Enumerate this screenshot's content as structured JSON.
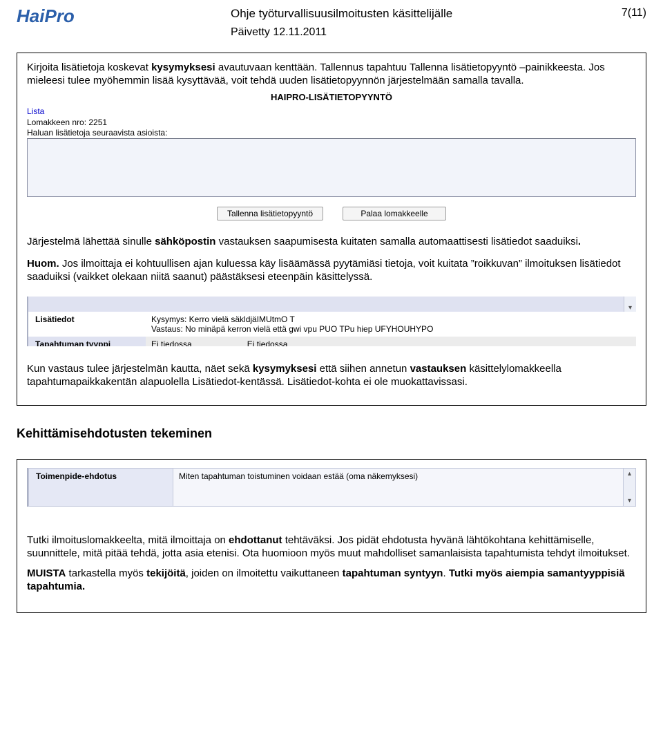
{
  "header": {
    "logo": "HaiPro",
    "title": "Ohje työturvallisuusilmoitusten käsittelijälle",
    "updated": "Päivetty 12.11.2011",
    "pagenum": "7(11)"
  },
  "box1": {
    "p1a": "Kirjoita lisätietoja koskevat ",
    "p1b": "kysymyksesi",
    "p1c": " avautuvaan kenttään. Tallennus tapahtuu Tallenna lisätietopyyntö –painikkeesta. ",
    "p2a": "J",
    "p2b": "os mieleesi tulee myöhemmin lisää kysyttävää, voit tehdä uuden lisätietopyynnön järjestelmään samalla tavalla.",
    "shot1": {
      "title": "HAIPRO-LISÄTIETOPYYNTÖ",
      "link": "Lista",
      "line1": "Lomakkeen nro: 2251",
      "line2": "Haluan lisätietoja seuraavista asioista:",
      "btn1": "Tallenna lisätietopyyntö",
      "btn2": "Palaa lomakkeelle"
    },
    "p3a": "Järjestelmä lähettää sinulle ",
    "p3b": "sähköpostin",
    "p3c": " vastauksen saapumisesta kuitaten samalla automaattisesti lisätiedot saaduiksi",
    "p3d": ".",
    "p4a": "Huom.",
    "p4b": " Jos ilmoittaja ei kohtuullisen ajan kuluessa käy lisäämässä pyytämiäsi tietoja, voit kuitata ”roikkuvan” ilmoituksen lisätiedot saaduiksi (vaikket olekaan niitä saanut) päästäksesi eteenpäin käsittelyssä.",
    "shot2": {
      "labelA": "Lisätiedot",
      "q_label": "Kysymys: ",
      "q_text": "Kerro vielä säkldjäIMUtmO T",
      "a_label": "Vastaus: ",
      "a_text": "No minäpä kerron vielä että gwi vpu PUO TPu hiep UFYHOUHYPO",
      "labelB": "Tapahtuman tyyppi",
      "val1": "Ei tiedossa",
      "val2": "Ei tiedossa"
    },
    "p5a": "Kun vastaus tulee järjestelmän kautta, näet sekä ",
    "p5b": "kysymyksesi",
    "p5c": " että siihen annetun ",
    "p5d": "vastauksen",
    "p5e": " käsittelylomakkeella tapahtumapaikkakentän alapuolella Lisätiedot-kentässä. Lisätiedot-kohta ei ole muokattavissasi."
  },
  "section_heading": "Kehittämisehdotusten tekeminen",
  "box2": {
    "shot3": {
      "label": "Toimenpide-ehdotus",
      "text": "Miten tapahtuman toistuminen voidaan estää (oma näkemyksesi)"
    },
    "p1a": "Tutki ilmoituslomakkeelta, mitä ilmoittaja on ",
    "p1b": "ehdottanut",
    "p1c": " tehtäväksi. Jos pidät ehdotusta hyvänä lähtökohtana kehittämiselle, suunnittele, mitä pitää tehdä, jotta asia etenisi. Ota huomioon myös muut mahdolliset samanlaisista tapahtumista tehdyt ilmoitukset.",
    "p2a": "MUISTA",
    "p2b": " tarkastella  myös ",
    "p2c": "tekijöitä",
    "p2d": ", joiden on ilmoitettu vaikuttaneen ",
    "p2e": "tapahtuman syntyyn",
    "p2f": ". ",
    "p2g": "Tutki myös aiempia samantyyppisiä tapahtumia."
  }
}
